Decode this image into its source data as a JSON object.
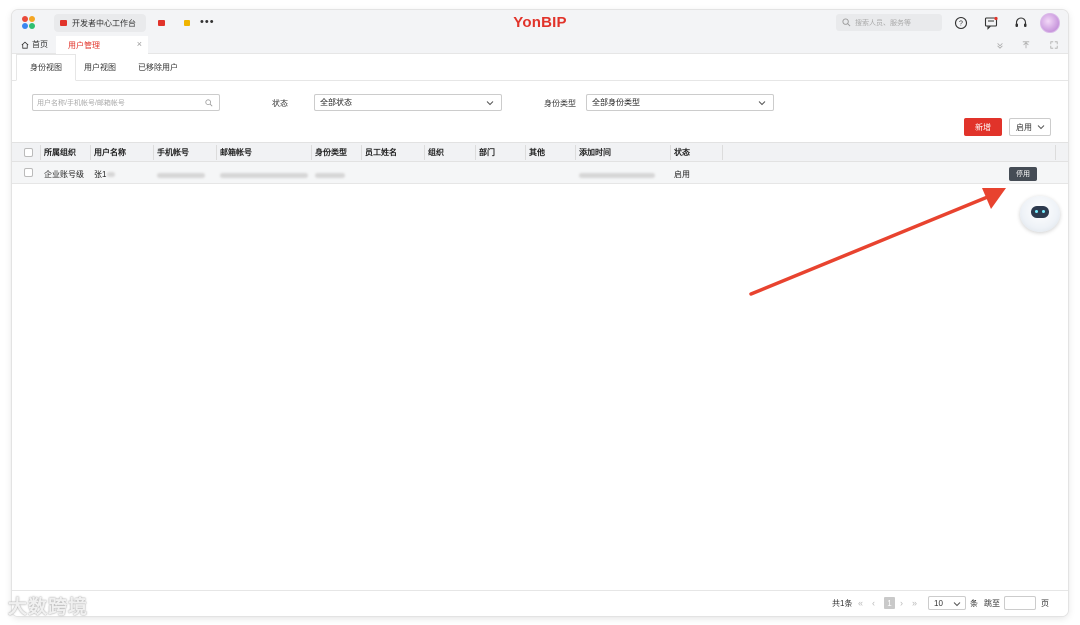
{
  "brand": "YonBIP",
  "top_tabs": [
    {
      "label": "开发者中心工作台",
      "color": "#e1332a"
    },
    {
      "label": "",
      "color": "#e1332a"
    },
    {
      "label": "",
      "color": "#f0b400"
    }
  ],
  "more": "•••",
  "search_placeholder": "搜索人员、服务等",
  "icons": [
    "help-icon",
    "message-icon",
    "headset-icon"
  ],
  "nav": {
    "home": "首页",
    "active_tab": "用户管理",
    "close": "×"
  },
  "view_tabs": [
    "身份视图",
    "用户视图",
    "已移除用户"
  ],
  "filters": {
    "search_placeholder": "用户名称/手机帐号/邮箱帐号",
    "status_label": "状态",
    "status_value": "全部状态",
    "type_label": "身份类型",
    "type_value": "全部身份类型"
  },
  "buttons": {
    "new": "新增",
    "enable": "启用",
    "disable": "停用"
  },
  "table": {
    "headers": [
      "所属组织",
      "用户名称",
      "手机帐号",
      "邮箱帐号",
      "身份类型",
      "员工姓名",
      "组织",
      "部门",
      "其他",
      "添加时间",
      "状态"
    ],
    "rows": [
      {
        "org": "企业账号级",
        "name": "张1",
        "phone": "",
        "email": "",
        "type": "",
        "employee": "",
        "unit": "",
        "dept": "",
        "other": "",
        "added": "",
        "status": "启用"
      }
    ]
  },
  "pager": {
    "total": "共1条",
    "page": "1",
    "page_size": "10",
    "per": "条",
    "jump": "跳至",
    "page_unit": "页"
  },
  "watermark": "大数跨境",
  "accent_color": "#e1332a"
}
